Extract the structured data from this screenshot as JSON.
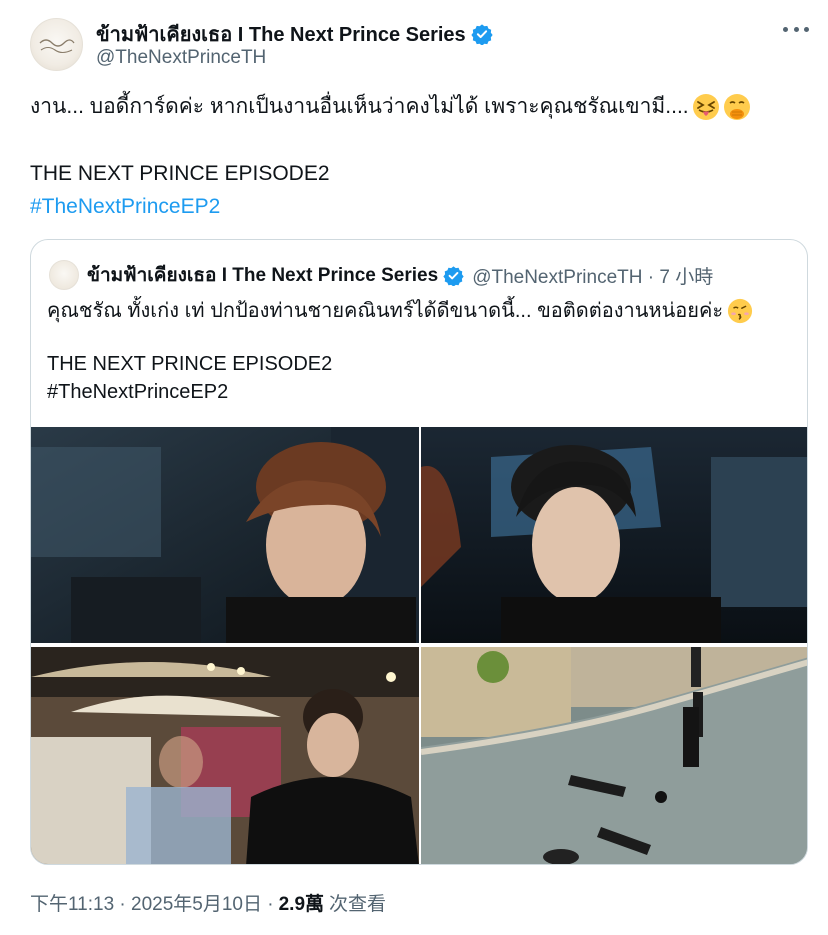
{
  "author": {
    "name": "ข้ามฟ้าเคียงเธอ I The Next Prince Series",
    "handle": "@TheNextPrinceTH",
    "avatar_text": "ข้ามฟ้าเคียงเธอ",
    "verified_icon": "verified-badge-icon"
  },
  "tweet": {
    "line1": "งาน... บอดี้การ์ดค่ะ หากเป็นงานอื่นเห็นว่าคงไม่ได้ เพราะคุณชรัณเขามี....",
    "line1_emojis": [
      "squinting-tongue-emoji",
      "hand-over-mouth-emoji"
    ],
    "line2": "THE NEXT PRINCE EPISODE2",
    "hashtag": "#TheNextPrinceEP2"
  },
  "quote": {
    "name": "ข้ามฟ้าเคียงเธอ I The Next Prince Series",
    "meta": "@TheNextPrinceTH · 7 小時",
    "line1": "คุณชรัณ ทั้งเก่ง เท่ ปกป้องท่านชายคณินทร์ได้ดีขนาดนี้... ขอติดต่องานหน่อยค่ะ",
    "line1_emoji": "kissing-face-emoji",
    "line2": "THE NEXT PRINCE EPISODE2",
    "line3": "#TheNextPrinceEP2",
    "photos": [
      "photo-car-back-seat",
      "photo-car-look-back",
      "photo-street-night",
      "photo-road-fight-aftermath"
    ]
  },
  "footer": {
    "timestamp": "下午11:13 · 2025年5月10日 ·",
    "views_count": "2.9萬",
    "views_label": "次查看"
  },
  "colors": {
    "text": "#0f1419",
    "secondary": "#536471",
    "link": "#1d9bf0",
    "border": "#cfd9de"
  }
}
